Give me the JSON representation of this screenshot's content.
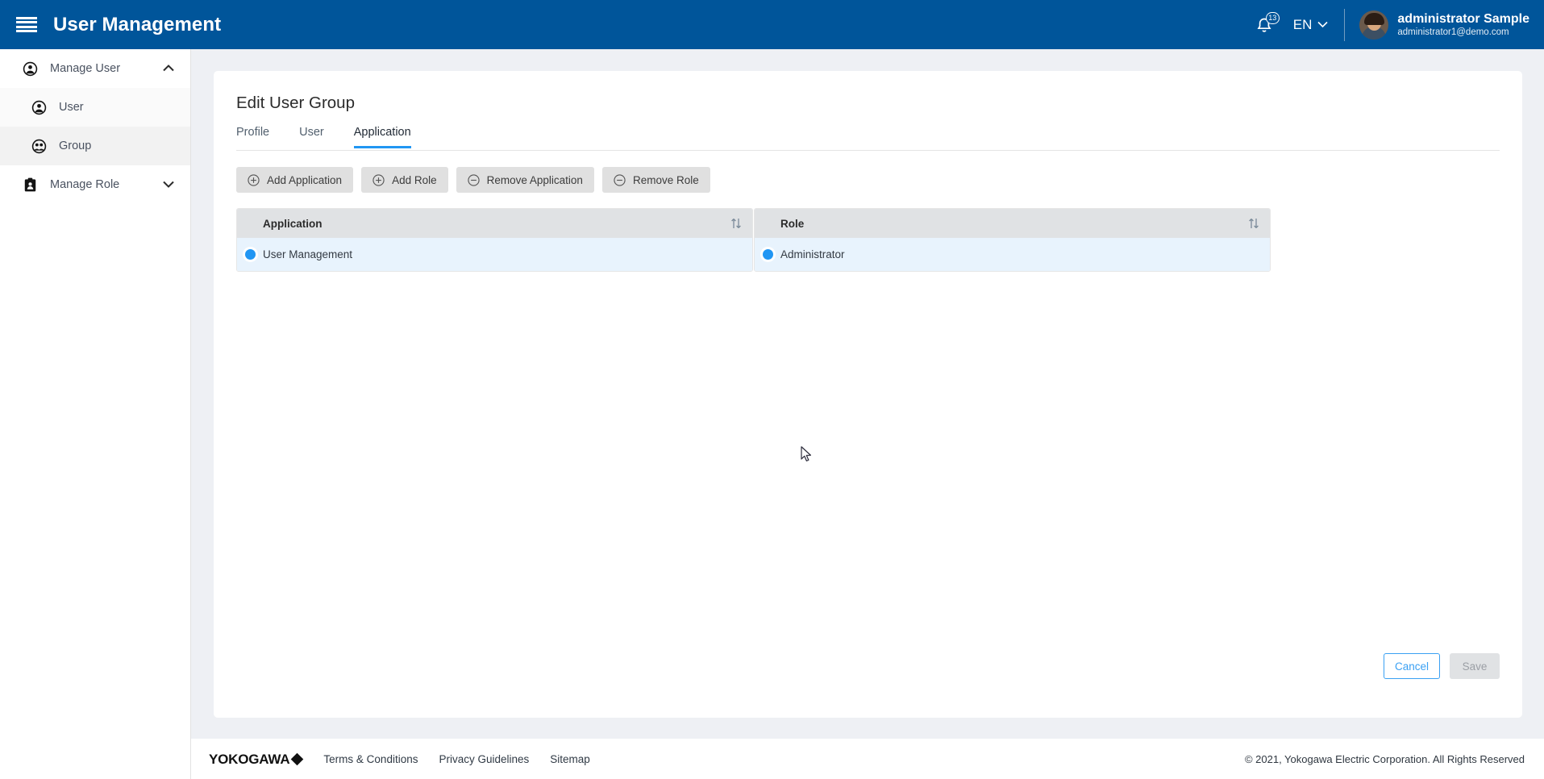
{
  "header": {
    "title": "User Management",
    "menu_icon": "hamburger-icon",
    "notification_count": "13",
    "language": "EN",
    "user_name": "administrator Sample",
    "user_email": "administrator1@demo.com"
  },
  "sidebar": {
    "items": [
      {
        "label": "Manage User",
        "icon": "user-icon",
        "level": "top",
        "expanded": true,
        "chevron": "chevron-up"
      },
      {
        "label": "User",
        "icon": "user-icon",
        "level": "sub",
        "active": false
      },
      {
        "label": "Group",
        "icon": "group-icon",
        "level": "sub",
        "active": true
      },
      {
        "label": "Manage Role",
        "icon": "badge-icon",
        "level": "top",
        "expanded": false,
        "chevron": "chevron-down"
      }
    ]
  },
  "main": {
    "page_title": "Edit User Group",
    "tabs": [
      {
        "label": "Profile",
        "active": false
      },
      {
        "label": "User",
        "active": false
      },
      {
        "label": "Application",
        "active": true
      }
    ],
    "toolbar": [
      {
        "label": "Add Application",
        "icon": "plus-circle-icon"
      },
      {
        "label": "Add Role",
        "icon": "plus-circle-icon"
      },
      {
        "label": "Remove Application",
        "icon": "minus-circle-icon"
      },
      {
        "label": "Remove Role",
        "icon": "minus-circle-icon"
      }
    ],
    "tables": [
      {
        "header": "Application",
        "sort_icon": "sort-updown-icon",
        "rows": [
          {
            "label": "User Management",
            "selected": true
          }
        ]
      },
      {
        "header": "Role",
        "sort_icon": "sort-updown-icon",
        "rows": [
          {
            "label": "Administrator",
            "selected": true
          }
        ]
      }
    ],
    "actions": {
      "cancel_label": "Cancel",
      "save_label": "Save"
    }
  },
  "footer": {
    "brand": "YOKOGAWA",
    "links": [
      "Terms & Conditions",
      "Privacy Guidelines",
      "Sitemap"
    ],
    "copyright": "© 2021, Yokogawa Electric Corporation. All Rights Reserved"
  },
  "colors": {
    "header_blue": "#00559a",
    "accent_blue": "#2196f3",
    "page_bg": "#eef0f4",
    "row_selected": "#e8f3fd",
    "table_head": "#e0e2e4"
  }
}
